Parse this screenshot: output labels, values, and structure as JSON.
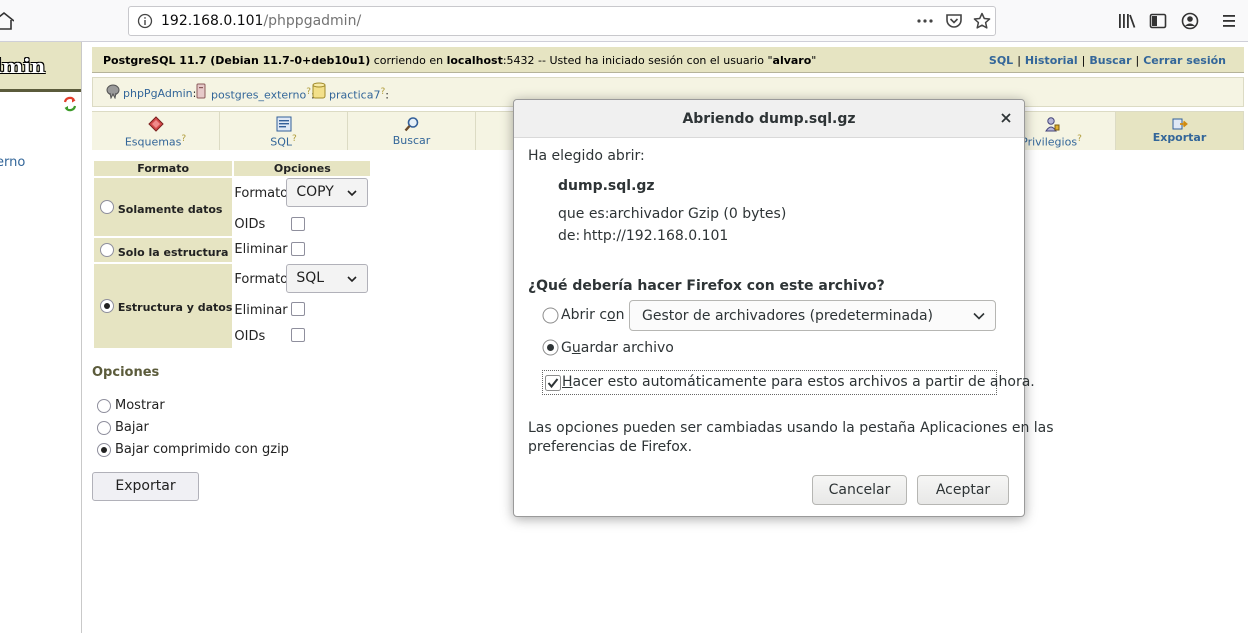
{
  "browser": {
    "url_host": "192.168.0.101",
    "url_path": "/phppgadmin/"
  },
  "left": {
    "logo_text": "dmin",
    "tree_link": "erno"
  },
  "topbar": {
    "server_version": "PostgreSQL 11.7 (Debian 11.7-0+deb10u1)",
    "running_on": "corriendo en",
    "host": "localhost",
    "port": ":5432",
    "session_text": "-- Usted ha iniciado sesión con el usuario \"",
    "user": "alvaro",
    "quote_end": "\"",
    "links": [
      "SQL",
      "Historial",
      "Buscar",
      "Cerrar sesión"
    ]
  },
  "trail": {
    "items": [
      "phpPgAdmin",
      "postgres_externo",
      "practica7"
    ],
    "sep": ":",
    "help": "?"
  },
  "tabs": [
    {
      "label": "Esquemas",
      "help": "?"
    },
    {
      "label": "SQL",
      "help": "?"
    },
    {
      "label": "Buscar",
      "help": ""
    },
    {
      "label": "",
      "help": ""
    },
    {
      "label": "",
      "help": ""
    },
    {
      "label": "",
      "help": ""
    },
    {
      "label": "",
      "help": ""
    },
    {
      "label": "Privilegios",
      "help": "?"
    },
    {
      "label": "Exportar",
      "help": ""
    }
  ],
  "export_form": {
    "headers": [
      "Formato",
      "Opciones"
    ],
    "data_only": "Solamente datos",
    "structure_only": "Solo la estructura",
    "structure_and_data": "Estructura y datos",
    "format_label": "Formato",
    "oids_label": "OIDs",
    "drop_label": "Eliminar",
    "format_data_value": "COPY",
    "format_both_value": "SQL",
    "options_heading": "Opciones",
    "output_options": [
      "Mostrar",
      "Bajar",
      "Bajar comprimido con gzip"
    ],
    "export_button": "Exportar"
  },
  "dialog": {
    "title": "Abriendo dump.sql.gz",
    "chosen": "Ha elegido abrir:",
    "filename": "dump.sql.gz",
    "type_label": "que es:",
    "type_value": "archivador Gzip (0 bytes)",
    "from_label": "de:",
    "from_value": "http://192.168.0.101",
    "question": "¿Qué debería hacer Firefox con este archivo?",
    "open_with_pre": "Abrir c",
    "open_with_u": "o",
    "open_with_post": "n",
    "open_with_app": "Gestor de archivadores (predeterminada)",
    "save_pre": "G",
    "save_u": "u",
    "save_post": "ardar archivo",
    "auto_u": "H",
    "auto_post": "acer esto automáticamente para estos archivos a partir de ahora.",
    "note_line1": "Las opciones pueden ser cambiadas usando la pestaña Aplicaciones en las",
    "note_line2": "preferencias de Firefox.",
    "cancel": "Cancelar",
    "accept": "Aceptar"
  }
}
